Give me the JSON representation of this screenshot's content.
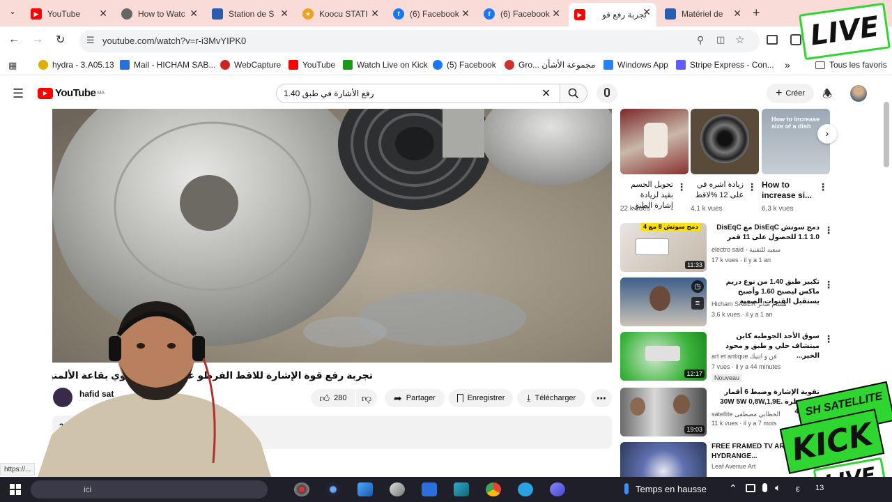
{
  "browser": {
    "tabs": [
      {
        "title": "YouTube",
        "icon": "youtube-icon",
        "color": "#ff0000",
        "active": false
      },
      {
        "title": "How to Watc",
        "icon": "globe-icon",
        "color": "#555555",
        "active": false
      },
      {
        "title": "Station de S",
        "icon": "station-icon",
        "color": "#2a5db0",
        "active": false
      },
      {
        "title": "Koocu STATI",
        "icon": "star-icon",
        "color": "#f0a020",
        "active": false
      },
      {
        "title": "(6) Facebook",
        "icon": "facebook-icon",
        "color": "#1877f2",
        "active": false
      },
      {
        "title": "(6) Facebook",
        "icon": "facebook-icon",
        "color": "#1877f2",
        "active": false
      },
      {
        "title": "تجربة رفع قو",
        "icon": "youtube-icon",
        "color": "#ff0000",
        "active": true
      },
      {
        "title": "Matériel de",
        "icon": "station-icon",
        "color": "#2a5db0",
        "active": false
      }
    ],
    "url": "youtube.com/watch?v=r-i3MvYIPK0",
    "bookmarks": [
      {
        "label": "hydra - 3.A05.13",
        "color": "#e0b000"
      },
      {
        "label": "Mail - HICHAM SAB...",
        "color": "#2a6fdb"
      },
      {
        "label": "WebCapture",
        "color": "#cc2222"
      },
      {
        "label": "YouTube",
        "color": "#ff0000"
      },
      {
        "label": "Watch Live on Kick",
        "color": "#1a9a1a"
      },
      {
        "label": "(5) Facebook",
        "color": "#1877f2"
      },
      {
        "label": "Gro... مجموعة الأشأن",
        "color": "#d03030"
      },
      {
        "label": "Windows App",
        "color": "#2a7fff"
      },
      {
        "label": "Stripe Express - Con...",
        "color": "#635bff"
      }
    ],
    "all_bookmarks_label": "Tous les favoris",
    "overflow_chevron": "»"
  },
  "youtube": {
    "logo_text": "YouTube",
    "logo_region": "MA",
    "search_query": "رفع الأشارة في طبق 1.40",
    "create_label": "Créer",
    "video": {
      "title": "تجربة رفع قوة الإشارة للاقط الفرطو على طبق بيضاوي بقاعة الألمنيوم العشوائية",
      "channel": "hafid sat",
      "likes": "280",
      "share_label": "Partager",
      "save_label": "Enregistrer",
      "download_label": "Télécharger",
      "description_snippet": "20"
    },
    "shorts": [
      {
        "caption": "تحويل الجسم بقيد لزيادة إشارة الطبق",
        "views": "22 k vues"
      },
      {
        "caption": "زيادة اشره في على 12 %لاقط",
        "views": "4,1 k vues"
      },
      {
        "caption": "How to increase si...",
        "views": "6,3 k vues",
        "overlay": "How to increase size of a dish"
      }
    ],
    "recommendations": [
      {
        "title": "دمج سوتش DisEqC مع DisEqC 1.1 1.0 للحصول على 11 قمر",
        "channel": "electro said - سعيد للتقنية",
        "meta": "17 k vues · il y a 1 an",
        "duration": "11:33",
        "thumb_text": "دمج سوتش 8 مع 4"
      },
      {
        "title": "تكبير طبق 1.40 من نوع دريم ماكس ليصبح 1.60 وأصبح يستقبل القنوات الصعبة",
        "channel": "Hicham SABER هشام صابر",
        "meta": "3,6 k vues · il y a 1 an",
        "duration": ""
      },
      {
        "title": "سوق الأحد الجوطية كاين ميتشاف حلي و طبق و محود الخير...",
        "channel": "art et antique فن و انتيك",
        "meta": "7 vues · il y a 44 minutes",
        "duration": "12:17",
        "badge": "Nouveau"
      },
      {
        "title": "تقوية الإشارة وضبط 6 أقمار بالمسطرة 30W 5W 0,8W,1,9E. 4,8E 9E",
        "channel": "satellite الخطابي مصطفى",
        "meta": "11 k vues · il y a 7 mois",
        "duration": "19:03"
      },
      {
        "title": "FREE FRAMED TV AR SUMMER HYDRANGE...",
        "channel": "Leaf Avenue Art",
        "meta": "",
        "duration": ""
      }
    ],
    "status_url": "https://..."
  },
  "taskbar": {
    "search_placeholder": "ici",
    "weather": "Temps en hausse",
    "tray_letter": "ε",
    "time_prefix": "13"
  },
  "overlays": {
    "live_top": "LIVE",
    "brand_top": "SH SATELLITE",
    "kick": "KICK",
    "live_bottom": "LIVE"
  },
  "colors": {
    "tabstrip": "#f9dbd8",
    "youtube_red": "#ff0000",
    "kick_green": "#2fd62f"
  }
}
